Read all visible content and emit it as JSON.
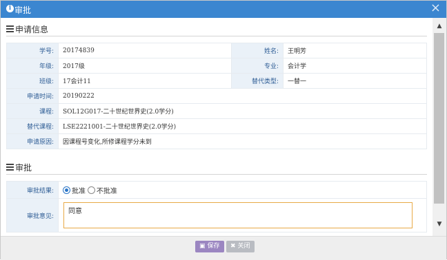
{
  "dialog": {
    "title": "审批",
    "close_glyph": "×",
    "info_icon_glyph": "i"
  },
  "application_section": {
    "title": "申请信息"
  },
  "application": {
    "student_id_label": "学号:",
    "student_id": "20174839",
    "name_label": "姓名:",
    "name": "王明芳",
    "grade_label": "年级:",
    "grade": "2017级",
    "major_label": "专业:",
    "major": "会计学",
    "class_label": "班级:",
    "class": "17会计11",
    "substitute_type_label": "替代类型:",
    "substitute_type": "一替一",
    "apply_time_label": "申请时间:",
    "apply_time": "20190222",
    "course_label": "课程:",
    "course": "SOL12G017-二十世纪世界史(2.0学分)",
    "substitute_course_label": "替代课程:",
    "substitute_course": "LSE2221001-二十世纪世界史(2.0学分)",
    "reason_label": "申请原因:",
    "reason": "因课程号变化,所修课程学分未到"
  },
  "approval_section": {
    "title": "审批"
  },
  "approval": {
    "result_label": "审批结果:",
    "option_approve": "批准",
    "option_reject": "不批准",
    "selected": "批准",
    "opinion_label": "审批意见:",
    "opinion_value": "同意"
  },
  "footer": {
    "save_label": "保存",
    "close_label": "关闭"
  },
  "colors": {
    "titlebar": "#3b86d0",
    "label_bg": "#eaf1f8",
    "save_button": "#9b86c1",
    "close_button": "#b9bcc2",
    "opinion_border": "#e8a945"
  },
  "icons": {
    "title": "info-circle-icon",
    "close": "close-icon",
    "section": "list-icon",
    "save": "save-icon",
    "close_btn": "close-x-icon"
  }
}
